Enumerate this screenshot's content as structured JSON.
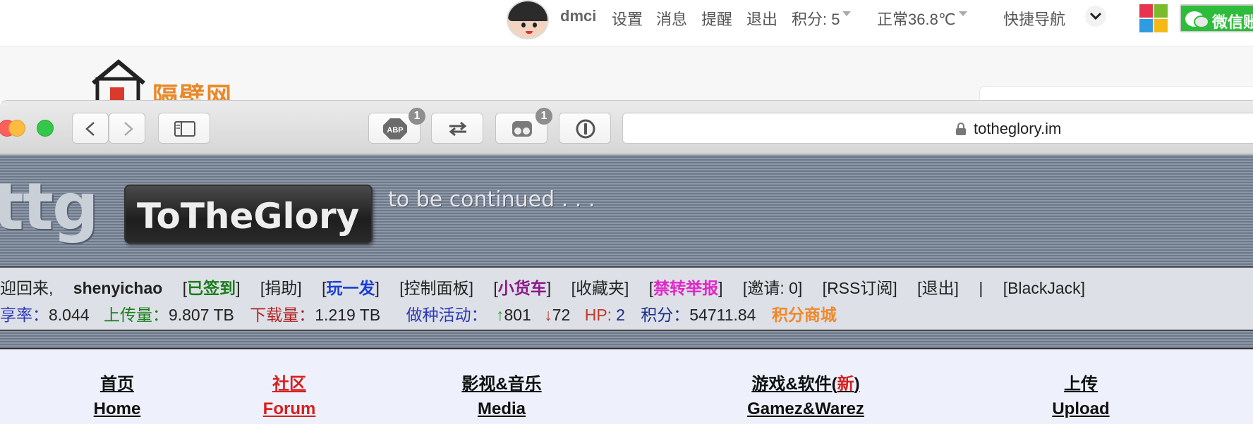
{
  "topbar": {
    "username": "dmci",
    "settings": "设置",
    "messages": "消息",
    "reminders": "提醒",
    "logout": "退出",
    "points": "积分: 5",
    "status": "正常36.8℃",
    "quicknav": "快捷导航",
    "wechat": "微信账"
  },
  "outer_site": {
    "logo_text": "隔壁网"
  },
  "browser": {
    "url": "totheglory.im",
    "adblock_label": "ABP",
    "adblock_badge": "1",
    "ghost_badge": "1"
  },
  "site": {
    "logo_short": "ttg",
    "logo_name": "ToTheGlory",
    "tagline": "to be continued . . ."
  },
  "infobar": {
    "welcome": "迎回来,",
    "username": "shenyichao",
    "links": {
      "signed_in": "已签到",
      "donate": "捐助",
      "play": "玩一发",
      "control_panel": "控制面板",
      "cart": "小货车",
      "favorites": "收藏夹",
      "report": "禁转举报",
      "invites": "邀请: 0",
      "rss": "RSS订阅",
      "logout": "退出",
      "separator": "|",
      "blackjack": "BlackJack"
    },
    "stats": {
      "ratio_label": "享率：",
      "ratio_value": "8.044",
      "upload_label": "上传量：",
      "upload_value": "9.807 TB",
      "download_label": "下载量：",
      "download_value": "1.219 TB",
      "seeding_label": "做种活动：",
      "seeding_up_arrow": "↑",
      "seeding_up": "801",
      "seeding_down_arrow": "↓",
      "seeding_down": "72",
      "hp_label": "HP:",
      "hp_value": "2",
      "points_label": "积分：",
      "points_value": "54711.84",
      "shop": "积分商城"
    }
  },
  "nav": [
    {
      "cn": "首页",
      "en": "Home"
    },
    {
      "cn": "社区",
      "en": "Forum"
    },
    {
      "cn": "影视&音乐",
      "en": "Media"
    },
    {
      "cn_a": "游戏&软件(",
      "cn_new": "新",
      "cn_b": ")",
      "en": "Gamez&Warez"
    },
    {
      "cn": "上传",
      "en": "Upload"
    }
  ],
  "colors": {
    "safari_close": "#fc605c",
    "safari_min": "#fdbc40",
    "safari_max": "#34c84a",
    "accent_orange": "#f0892c",
    "active_red": "#d61f1f"
  }
}
